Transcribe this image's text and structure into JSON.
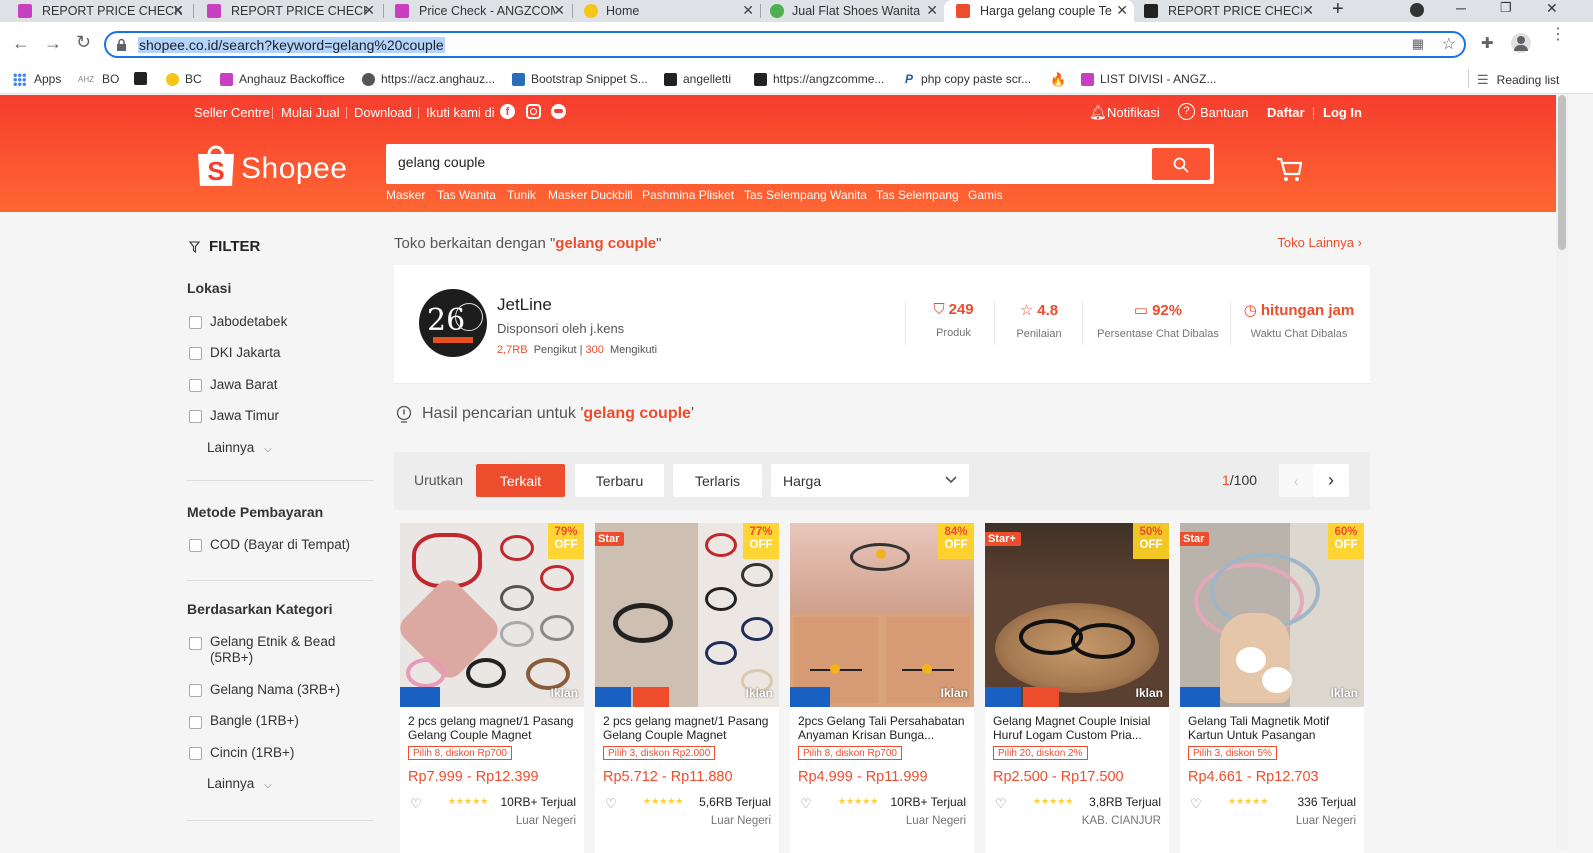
{
  "browser": {
    "tabs": [
      {
        "title": "REPORT PRICE CHECK L",
        "favicon_color": "#c83fbf"
      },
      {
        "title": "REPORT PRICE CHECK L",
        "favicon_color": "#c83fbf"
      },
      {
        "title": "Price Check - ANGZCOM",
        "favicon_color": "#c83fbf"
      },
      {
        "title": "Home",
        "favicon_color": "#f5c518"
      },
      {
        "title": "Jual Flat Shoes Wanita",
        "favicon_color": "#4caf50"
      },
      {
        "title": "Harga gelang couple Te",
        "favicon_color": "#ee4d2d"
      },
      {
        "title": "REPORT PRICE CHECK L",
        "favicon_color": "#222"
      }
    ],
    "new_tab": "+",
    "url": "shopee.co.id/search?keyword=gelang%20couple",
    "bookmarks": [
      {
        "label": "Apps",
        "color": "#4285f4"
      },
      {
        "label": "BO",
        "color": "#888"
      },
      {
        "label": "",
        "color": "#222"
      },
      {
        "label": "BC",
        "color": "#f5c518"
      },
      {
        "label": "Anghauz Backoffice",
        "color": "#c83fbf"
      },
      {
        "label": "https://acz.anghauz...",
        "color": "#555"
      },
      {
        "label": "Bootstrap Snippet S...",
        "color": "#2a6ebb"
      },
      {
        "label": "angelletti",
        "color": "#222"
      },
      {
        "label": "https://angzcomme...",
        "color": "#222"
      },
      {
        "label": "php copy paste scr...",
        "color": "#1e5aa8"
      },
      {
        "label": "",
        "color": "#e8501d"
      },
      {
        "label": "LIST DIVISI - ANGZ...",
        "color": "#c83fbf"
      }
    ],
    "reading_list": "Reading list"
  },
  "header": {
    "left_links": [
      "Seller Centre",
      "Mulai Jual",
      "Download",
      "Ikuti kami di"
    ],
    "notifications": "Notifikasi",
    "help": "Bantuan",
    "register": "Daftar",
    "login": "Log In",
    "logo_text": "Shopee",
    "search_value": "gelang couple",
    "keywords": [
      "Masker",
      "Tas Wanita",
      "Tunik",
      "Masker Duckbill",
      "Pashmina Plisket",
      "Tas Selempang Wanita",
      "Tas Selempang",
      "Gamis"
    ]
  },
  "sidebar": {
    "filter_title": "FILTER",
    "location_title": "Lokasi",
    "locations": [
      "Jabodetabek",
      "DKI Jakarta",
      "Jawa Barat",
      "Jawa Timur"
    ],
    "more": "Lainnya",
    "payment_title": "Metode Pembayaran",
    "payments": [
      "COD (Bayar di Tempat)"
    ],
    "category_title": "Berdasarkan Kategori",
    "categories": [
      "Gelang Etnik & Bead (5RB+)",
      "Gelang Nama (3RB+)",
      "Bangle (1RB+)",
      "Cincin (1RB+)"
    ]
  },
  "related_shops": {
    "prefix": "Toko berkaitan dengan \"",
    "keyword": "gelang couple",
    "suffix": "\"",
    "more_link": "Toko Lainnya"
  },
  "shop": {
    "name": "JetLine",
    "sponsor": "Disponsori oleh j.kens",
    "followers": "2,7RB",
    "followers_label": "Pengikut |",
    "following": "300",
    "following_label": "Mengikuti",
    "stats": [
      {
        "value": "249",
        "label": "Produk"
      },
      {
        "value": "4.8",
        "label": "Penilaian"
      },
      {
        "value": "92%",
        "label": "Persentase Chat Dibalas"
      },
      {
        "value": "hitungan jam",
        "label": "Waktu Chat Dibalas"
      }
    ]
  },
  "results": {
    "prefix": "Hasil pencarian untuk '",
    "keyword": "gelang couple",
    "suffix": "'"
  },
  "sort": {
    "label": "Urutkan",
    "options": [
      "Terkait",
      "Terbaru",
      "Terlaris"
    ],
    "price_select": "Harga",
    "page_current": "1",
    "page_total": "/100"
  },
  "products": [
    {
      "discount": "79%",
      "off": "OFF",
      "star": "",
      "name": "2 pcs gelang magnet/1 Pasang Gelang Couple Magnet Gelang...",
      "voucher": "Pilih 8, diskon Rp700",
      "price": "Rp7.999 - Rp12.399",
      "sold": "10RB+ Terjual",
      "location": "Luar Negeri",
      "ad": "Iklan",
      "bg": "#e9e6e3",
      "accent": "#c1272d"
    },
    {
      "discount": "77%",
      "off": "OFF",
      "star": "Star",
      "name": "2 pcs gelang magnet/1 Pasang Gelang Couple Magnet Gelang...",
      "voucher": "Pilih 3, diskon Rp2.000",
      "price": "Rp5.712 - Rp11.880",
      "sold": "5,6RB Terjual",
      "location": "Luar Negeri",
      "ad": "Iklan",
      "bg": "#ece7e2",
      "accent": "#1f1f3a"
    },
    {
      "discount": "84%",
      "off": "OFF",
      "star": "",
      "name": "2pcs Gelang Tali Persahabatan Anyaman Krisan Bunga...",
      "voucher": "Pilih 8, diskon Rp700",
      "price": "Rp4.999 - Rp11.999",
      "sold": "10RB+ Terjual",
      "location": "Luar Negeri",
      "ad": "Iklan",
      "bg": "#d9a27d",
      "accent": "#e7b8ac"
    },
    {
      "discount": "50%",
      "off": "OFF",
      "star": "Star+",
      "name": "Gelang Magnet Couple Inisial Huruf Logam Custom Pria...",
      "voucher": "Pilih 20, diskon 2%",
      "price": "Rp2.500 - Rp17.500",
      "sold": "3,8RB Terjual",
      "location": "KAB. CIANJUR",
      "ad": "Iklan",
      "bg": "#7a5a3c",
      "accent": "#c79a6b"
    },
    {
      "discount": "60%",
      "off": "OFF",
      "star": "Star",
      "name": "Gelang Tali Magnetik Motif Kartun Untuk Pasangan",
      "voucher": "Pilih 3, diskon 5%",
      "price": "Rp4.661 - Rp12.703",
      "sold": "336 Terjual",
      "location": "Luar Negeri",
      "ad": "Iklan",
      "bg": "#b9b3ab",
      "accent": "#e3a9b9"
    }
  ],
  "colors": {
    "brand": "#ee4d2d",
    "header_top": "#f53d2d",
    "header_bottom": "#ff6633"
  }
}
